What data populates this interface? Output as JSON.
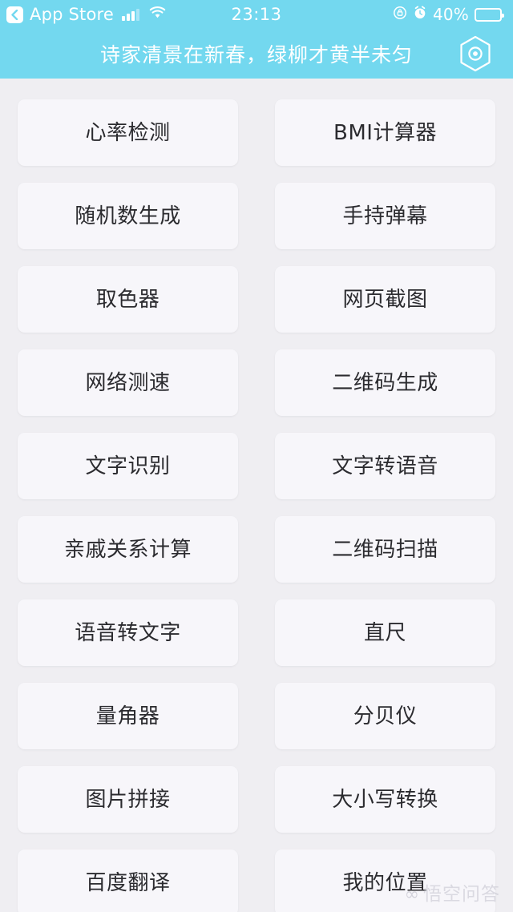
{
  "status_bar": {
    "back_label": "App Store",
    "back_icon": "chevron-left-icon",
    "signal_icon": "cellular-signal-icon",
    "wifi_icon": "wifi-icon",
    "time": "23:13",
    "rotation_lock_icon": "rotation-lock-icon",
    "alarm_icon": "alarm-clock-icon",
    "battery_percent": "40%",
    "battery_icon": "battery-icon",
    "battery_level": 40,
    "background_color": "#73d8ef",
    "text_color": "#ffffff"
  },
  "header": {
    "title": "诗家清景在新春，绿柳才黄半未匀",
    "action_icon": "hexagon-camera-icon",
    "background_color": "#73d8ef",
    "title_color": "#ffffff"
  },
  "grid": {
    "background_color": "#efeef2",
    "tile_color": "#f7f6fa",
    "tile_text_color": "#2b2b2f",
    "columns": 2,
    "tiles": [
      {
        "label": "心率检测"
      },
      {
        "label": "BMI计算器"
      },
      {
        "label": "随机数生成"
      },
      {
        "label": "手持弹幕"
      },
      {
        "label": "取色器"
      },
      {
        "label": "网页截图"
      },
      {
        "label": "网络测速"
      },
      {
        "label": "二维码生成"
      },
      {
        "label": "文字识别"
      },
      {
        "label": "文字转语音"
      },
      {
        "label": "亲戚关系计算"
      },
      {
        "label": "二维码扫描"
      },
      {
        "label": "语音转文字"
      },
      {
        "label": "直尺"
      },
      {
        "label": "量角器"
      },
      {
        "label": "分贝仪"
      },
      {
        "label": "图片拼接"
      },
      {
        "label": "大小写转换"
      },
      {
        "label": "百度翻译"
      },
      {
        "label": "我的位置"
      }
    ]
  },
  "watermark": {
    "mark": "∞",
    "text": "悟空问答"
  }
}
